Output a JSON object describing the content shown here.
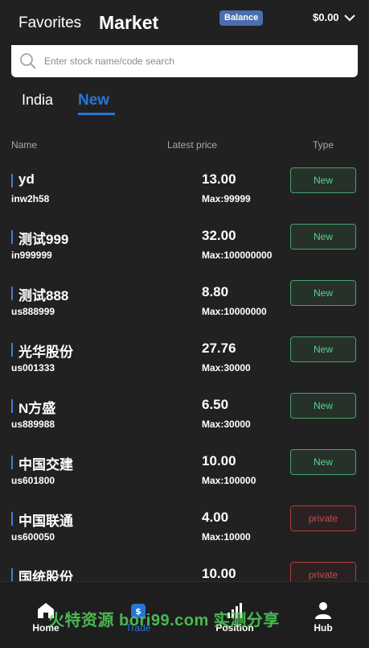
{
  "header": {
    "favorites_label": "Favorites",
    "market_label": "Market",
    "balance_badge": "Balance",
    "amount": "$0.00"
  },
  "search": {
    "placeholder": "Enter stock name/code search"
  },
  "subtabs": {
    "india": "India",
    "new": "New"
  },
  "columns": {
    "name": "Name",
    "price": "Latest price",
    "type": "Type"
  },
  "stocks": [
    {
      "name": "yd",
      "code": "inw2h58",
      "price": "13.00",
      "max": "Max:99999",
      "type": "New"
    },
    {
      "name": "测试999",
      "code": "in999999",
      "price": "32.00",
      "max": "Max:100000000",
      "type": "New"
    },
    {
      "name": "测试888",
      "code": "us888999",
      "price": "8.80",
      "max": "Max:10000000",
      "type": "New"
    },
    {
      "name": "光华股份",
      "code": "us001333",
      "price": "27.76",
      "max": "Max:30000",
      "type": "New"
    },
    {
      "name": "N方盛",
      "code": "us889988",
      "price": "6.50",
      "max": "Max:30000",
      "type": "New"
    },
    {
      "name": "中国交建",
      "code": "us601800",
      "price": "10.00",
      "max": "Max:100000",
      "type": "New"
    },
    {
      "name": "中国联通",
      "code": "us600050",
      "price": "4.00",
      "max": "Max:10000",
      "type": "private"
    },
    {
      "name": "国统股份",
      "code": "",
      "price": "10.00",
      "max": "",
      "type": "private"
    }
  ],
  "nav": {
    "home": "Home",
    "trade": "Trade",
    "position": "Position",
    "hub": "Hub"
  },
  "watermark": "火特资源 bori99.com 实测分享",
  "colors": {
    "accent": "#2b73d6",
    "new_badge": "#5fd08f",
    "private_badge": "#d04848",
    "background": "#212121"
  }
}
